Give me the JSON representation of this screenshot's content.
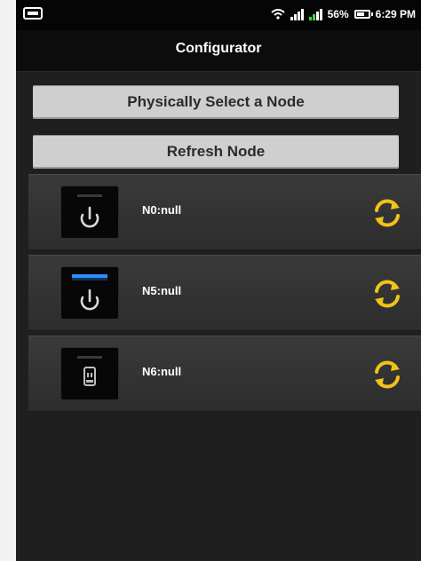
{
  "status_bar": {
    "battery": "56%",
    "time": "6:29 PM",
    "icons": [
      "notification-icon",
      "wifi-icon",
      "signal-icon",
      "battery-icon"
    ]
  },
  "header": {
    "title": "Configurator"
  },
  "actions": {
    "select_node": "Physically Select a Node",
    "refresh_node": "Refresh Node"
  },
  "nodes": [
    {
      "label": "N0:null",
      "icon": "power-icon",
      "indicator": "gray"
    },
    {
      "label": "N5:null",
      "icon": "power-icon",
      "indicator": "blue"
    },
    {
      "label": "N6:null",
      "icon": "plug-icon",
      "indicator": "gray"
    }
  ],
  "colors": {
    "refresh_accent": "#f2c21b",
    "indicator_blue": "#2f8fff",
    "signal_green": "#47d147"
  }
}
